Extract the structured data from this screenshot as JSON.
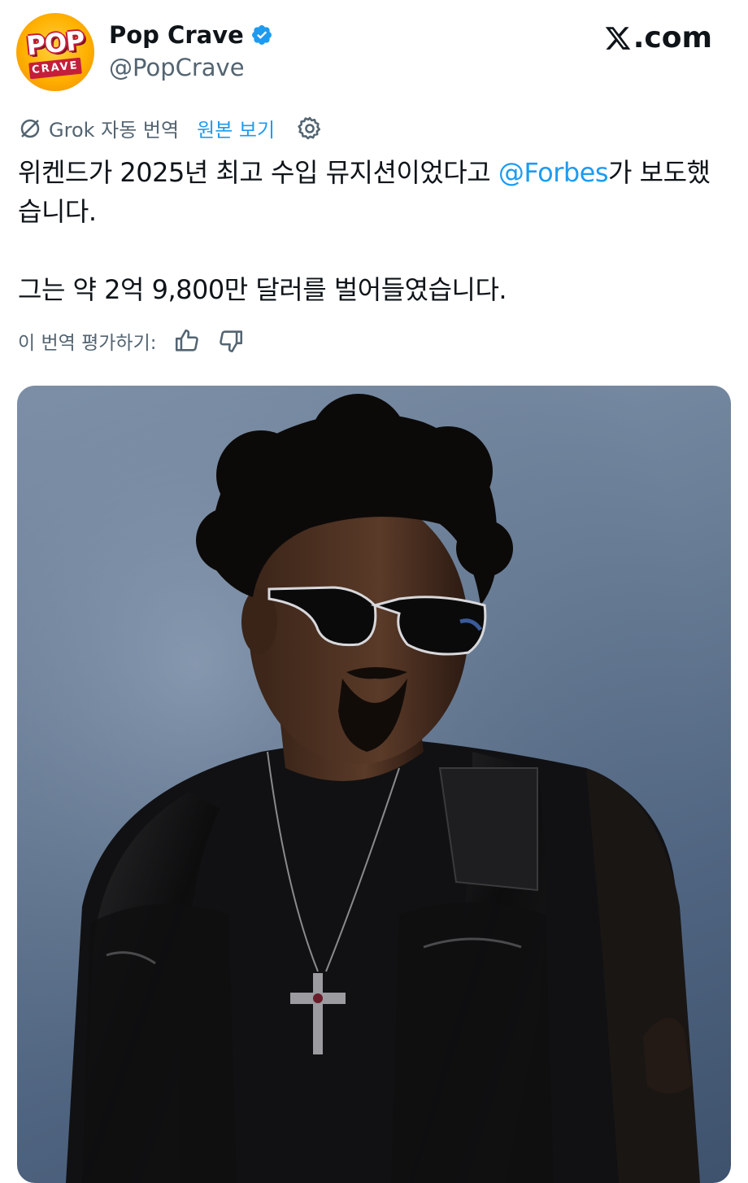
{
  "header": {
    "avatar_text_top": "POP",
    "avatar_text_bottom": "CRAVE",
    "display_name": "Pop Crave",
    "handle": "@PopCrave",
    "site_brand": ".com",
    "verified_icon": "verified-badge-icon",
    "brand_icon": "x-logo-icon"
  },
  "translation": {
    "icon": "grok-icon",
    "label": "Grok 자동 번역",
    "show_original": "원본 보기",
    "settings_icon": "gear-icon"
  },
  "tweet": {
    "line1_before": "위켄드가 2025년 최고 수입 뮤지션이었다고 ",
    "mention": "@Forbes",
    "line1_after": "가 보도했습니다.",
    "paragraph2": "그는 약 2억 9,800만 달러를 벌어들였습니다."
  },
  "rating": {
    "label": "이 번역 평가하기:",
    "like_icon": "thumbs-up-icon",
    "dislike_icon": "thumbs-down-icon"
  },
  "media": {
    "description_icon": "photo-image"
  },
  "colors": {
    "accent": "#1d9bf0",
    "text": "#0f1419",
    "muted": "#536471",
    "brand": "#ffb000"
  }
}
